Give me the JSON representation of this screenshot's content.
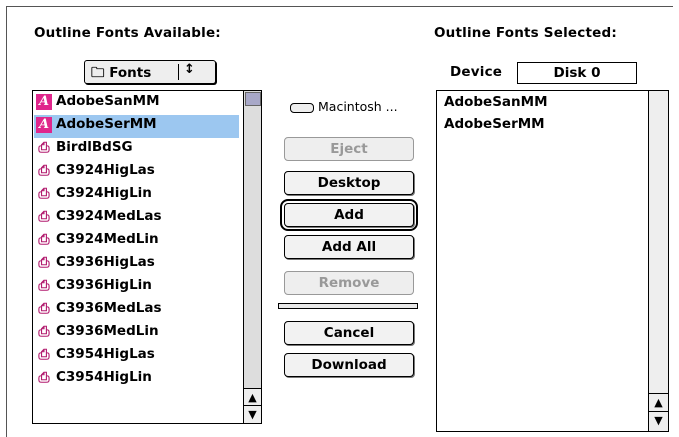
{
  "labels": {
    "available": "Outline Fonts Available:",
    "selected": "Outline Fonts Selected:",
    "device": "Device"
  },
  "popup": {
    "value": "Fonts",
    "arrows": "↕"
  },
  "fonts_available": [
    {
      "name": "AdobeSanMM",
      "icon": "adobe-mm-icon",
      "selected": false
    },
    {
      "name": "AdobeSerMM",
      "icon": "adobe-mm-icon",
      "selected": true
    },
    {
      "name": "BirdlBdSG",
      "icon": "printer-font-icon",
      "selected": false
    },
    {
      "name": "C3924HigLas",
      "icon": "printer-font-icon",
      "selected": false
    },
    {
      "name": "C3924HigLin",
      "icon": "printer-font-icon",
      "selected": false
    },
    {
      "name": "C3924MedLas",
      "icon": "printer-font-icon",
      "selected": false
    },
    {
      "name": "C3924MedLin",
      "icon": "printer-font-icon",
      "selected": false
    },
    {
      "name": "C3936HigLas",
      "icon": "printer-font-icon",
      "selected": false
    },
    {
      "name": "C3936HigLin",
      "icon": "printer-font-icon",
      "selected": false
    },
    {
      "name": "C3936MedLas",
      "icon": "printer-font-icon",
      "selected": false
    },
    {
      "name": "C3936MedLin",
      "icon": "printer-font-icon",
      "selected": false
    },
    {
      "name": "C3954HigLas",
      "icon": "printer-font-icon",
      "selected": false
    },
    {
      "name": "C3954HigLin",
      "icon": "printer-font-icon",
      "selected": false
    }
  ],
  "disk": {
    "name": "Macintosh ..."
  },
  "buttons": {
    "eject": "Eject",
    "desktop": "Desktop",
    "add": "Add",
    "add_all": "Add All",
    "remove": "Remove",
    "cancel": "Cancel",
    "download": "Download"
  },
  "device_value": "Disk 0",
  "fonts_selected": [
    "AdobeSanMM",
    "AdobeSerMM"
  ],
  "colors": {
    "selection": "#9cc7f0",
    "adobe_icon": "#e0268c",
    "scroll_thumb": "#a8a8c8"
  }
}
